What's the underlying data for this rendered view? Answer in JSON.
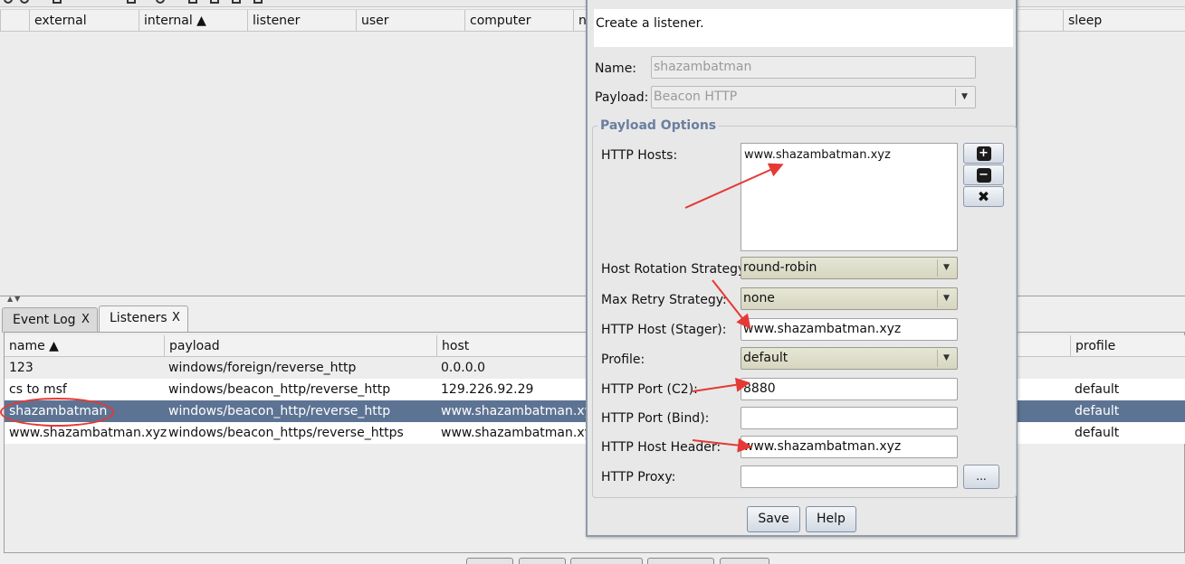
{
  "sessions_table": {
    "columns": [
      "external",
      "internal ▲",
      "listener",
      "user",
      "computer",
      "n",
      "sleep"
    ]
  },
  "tabs": [
    {
      "label": "Event Log",
      "close": "X"
    },
    {
      "label": "Listeners",
      "close": "X"
    }
  ],
  "listeners_table": {
    "columns": [
      "name ▲",
      "payload",
      "host",
      "profile"
    ],
    "rows": [
      {
        "name": "123",
        "payload": "windows/foreign/reverse_http",
        "host": "0.0.0.0",
        "profile": ""
      },
      {
        "name": "cs to msf",
        "payload": "windows/beacon_http/reverse_http",
        "host": "129.226.92.29",
        "profile": "default"
      },
      {
        "name": "shazambatman",
        "payload": "windows/beacon_http/reverse_http",
        "host": "www.shazambatman.xyz",
        "profile": "default"
      },
      {
        "name": "www.shazambatman.xyz",
        "payload": "windows/beacon_https/reverse_https",
        "host": "www.shazambatman.xyz",
        "profile": "default"
      }
    ]
  },
  "dialog": {
    "description": "Create a listener.",
    "name_label": "Name:",
    "name_value": "shazambatman",
    "payload_label": "Payload:",
    "payload_value": "Beacon HTTP",
    "group_title": "Payload Options",
    "http_hosts_label": "HTTP Hosts:",
    "http_hosts": [
      "www.shazambatman.xyz"
    ],
    "host_rotation_label": "Host Rotation Strategy:",
    "host_rotation_value": "round-robin",
    "max_retry_label": "Max Retry Strategy:",
    "max_retry_value": "none",
    "host_stager_label": "HTTP Host (Stager):",
    "host_stager_value": "www.shazambatman.xyz",
    "profile_label": "Profile:",
    "profile_value": "default",
    "port_c2_label": "HTTP Port (C2):",
    "port_c2_value": "8880",
    "port_bind_label": "HTTP Port (Bind):",
    "port_bind_value": "",
    "host_header_label": "HTTP Host Header:",
    "host_header_value": "www.shazambatman.xyz",
    "proxy_label": "HTTP Proxy:",
    "proxy_value": "",
    "proxy_button": "...",
    "add_glyph": "+",
    "remove_glyph": "−",
    "clear_glyph": "✖",
    "save_label": "Save",
    "help_label": "Help"
  },
  "colors": {
    "selected_row": "#5d7393",
    "annotation_red": "#e53935",
    "group_title": "#6a7fa0",
    "combo_bg": "#dcdcc8"
  },
  "icons": [
    "plus-icon",
    "minus-icon",
    "clear-icon",
    "dropdown-arrow-icon",
    "sort-ascending-icon",
    "annotation-arrow"
  ]
}
